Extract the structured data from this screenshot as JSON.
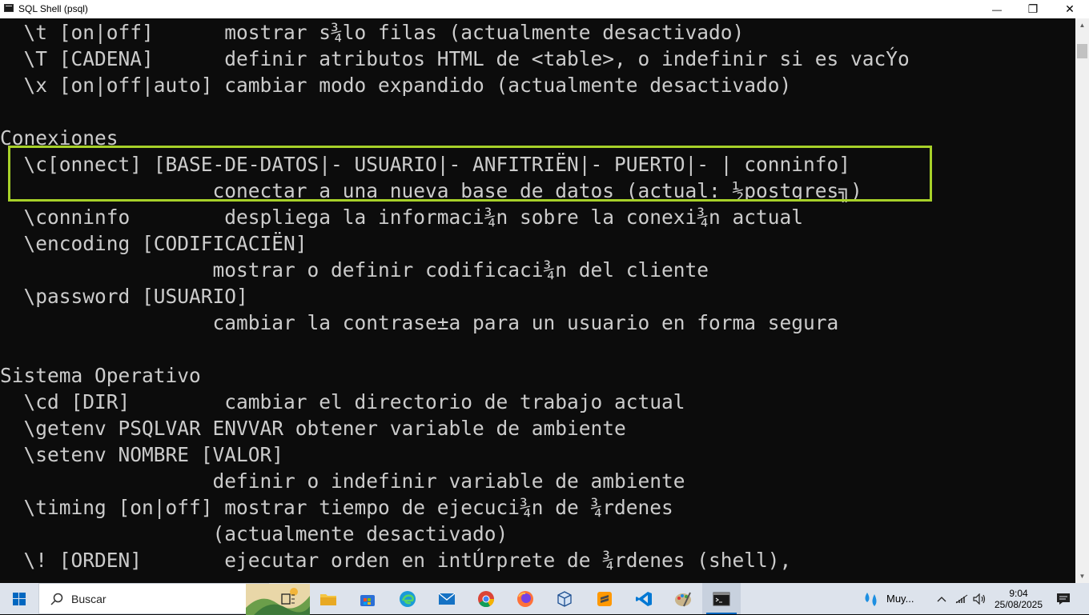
{
  "window": {
    "title": "SQL Shell (psql)",
    "controls": {
      "minimize": "—",
      "maximize": "❐",
      "close": "✕"
    }
  },
  "terminal": {
    "lines": [
      "  \\t [on|off]      mostrar s¾lo filas (actualmente desactivado)",
      "  \\T [CADENA]      definir atributos HTML de <table>, o indefinir si es vacÝo",
      "  \\x [on|off|auto] cambiar modo expandido (actualmente desactivado)",
      "",
      "Conexiones",
      "  \\c[onnect] [BASE-DE-DATOS|- USUARIO|- ANFITRIËN|- PUERTO|- | conninfo]",
      "                  conectar a una nueva base de datos (actual: ½postgres╗)",
      "  \\conninfo        despliega la informaci¾n sobre la conexi¾n actual",
      "  \\encoding [CODIFICACIËN]",
      "                  mostrar o definir codificaci¾n del cliente",
      "  \\password [USUARIO]",
      "                  cambiar la contrase±a para un usuario en forma segura",
      "",
      "Sistema Operativo",
      "  \\cd [DIR]        cambiar el directorio de trabajo actual",
      "  \\getenv PSQLVAR ENVVAR obtener variable de ambiente",
      "  \\setenv NOMBRE [VALOR]",
      "                  definir o indefinir variable de ambiente",
      "  \\timing [on|off] mostrar tiempo de ejecuci¾n de ¾rdenes",
      "                  (actualmente desactivado)",
      "  \\! [ORDEN]       ejecutar orden en intÚrprete de ¾rdenes (shell),"
    ],
    "colors": {
      "background": "#0c0c0c",
      "text": "#cccccc",
      "highlight": "#a7d129"
    }
  },
  "taskbar": {
    "search_label": "Buscar",
    "weather_text": "Muy...",
    "clock": {
      "time": "9:04",
      "date": "25/08/2025"
    },
    "apps": [
      "task-view-icon",
      "file-explorer-icon",
      "microsoft-store-icon",
      "edge-icon",
      "mail-icon",
      "chrome-icon",
      "firefox-icon",
      "virtualbox-icon",
      "sublime-text-icon",
      "vscode-icon",
      "paint-icon",
      "terminal-icon"
    ]
  }
}
